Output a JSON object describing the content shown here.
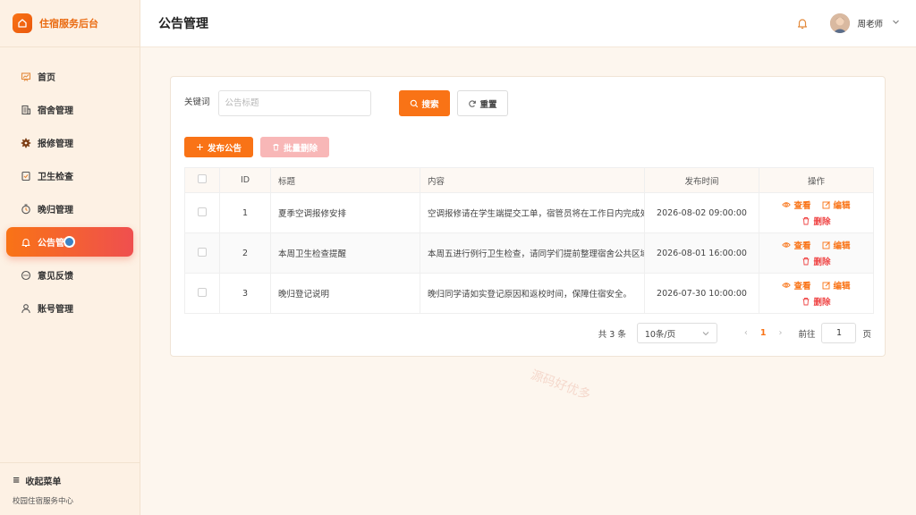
{
  "brand": {
    "title": "住宿服务后台"
  },
  "sidebar": {
    "items": [
      {
        "label": "首页",
        "icon": "chart-board-icon"
      },
      {
        "label": "宿舍管理",
        "icon": "building-icon"
      },
      {
        "label": "报修管理",
        "icon": "gear-icon"
      },
      {
        "label": "卫生检查",
        "icon": "checklist-icon"
      },
      {
        "label": "晚归管理",
        "icon": "timer-icon"
      },
      {
        "label": "公告管理",
        "icon": "bell-icon",
        "active": true
      },
      {
        "label": "意见反馈",
        "icon": "chat-icon"
      },
      {
        "label": "账号管理",
        "icon": "user-icon"
      }
    ],
    "collapse_label": "收起菜单",
    "footer_text": "校园住宿服务中心"
  },
  "header": {
    "title": "公告管理",
    "user_name": "周老师"
  },
  "search": {
    "keyword_label": "关键词",
    "keyword_placeholder": "公告标题",
    "keyword_value": "",
    "search_label": "搜索",
    "reset_label": "重置"
  },
  "actions": {
    "publish_label": "发布公告",
    "batch_delete_label": "批量删除"
  },
  "table": {
    "columns": [
      "",
      "ID",
      "标题",
      "内容",
      "发布时间",
      "操作"
    ],
    "rows": [
      {
        "id": "1",
        "title": "夏季空调报修安排",
        "content": "空调报修请在学生端提交工单，宿管员将在工作日内完成处理",
        "time": "2026-08-02 09:00:00"
      },
      {
        "id": "2",
        "title": "本周卫生检查提醒",
        "content": "本周五进行例行卫生检查，请同学们提前整理宿舍公共区域",
        "time": "2026-08-01 16:00:00"
      },
      {
        "id": "3",
        "title": "晚归登记说明",
        "content": "晚归同学请如实登记原因和返校时间，保障住宿安全。",
        "time": "2026-07-30 10:00:00"
      }
    ],
    "op_view": "查看",
    "op_edit": "编辑",
    "op_delete": "删除"
  },
  "pagination": {
    "total_text": "共 3 条",
    "page_size": "10条/页",
    "current_page": "1",
    "goto_label": "前往",
    "goto_value": "1",
    "page_unit": "页"
  },
  "watermark": "源码好优多",
  "colors": {
    "accent": "#f97316",
    "danger": "#ef4444",
    "sidebar_bg": "#fdf1e4"
  }
}
